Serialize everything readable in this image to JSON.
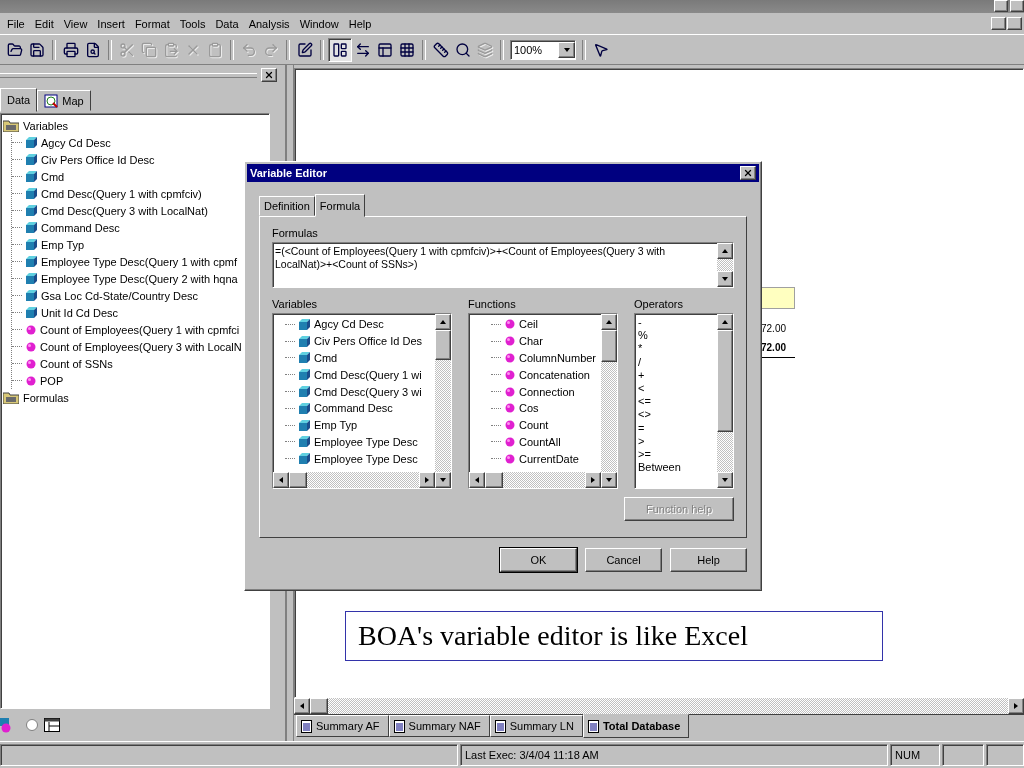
{
  "menu": [
    "File",
    "Edit",
    "View",
    "Insert",
    "Format",
    "Tools",
    "Data",
    "Analysis",
    "Window",
    "Help"
  ],
  "toolbar": [
    {
      "kind": "open",
      "disabled": false
    },
    {
      "kind": "save",
      "disabled": false
    },
    {
      "kind": "separator"
    },
    {
      "kind": "print",
      "disabled": false
    },
    {
      "kind": "preview",
      "disabled": false
    },
    {
      "kind": "separator"
    },
    {
      "kind": "cut",
      "disabled": true
    },
    {
      "kind": "copy",
      "disabled": true
    },
    {
      "kind": "paste",
      "disabled": true
    },
    {
      "kind": "delete",
      "disabled": true
    },
    {
      "kind": "clipboard",
      "disabled": true
    },
    {
      "kind": "separator"
    },
    {
      "kind": "undo",
      "disabled": true
    },
    {
      "kind": "redo",
      "disabled": true
    },
    {
      "kind": "separator"
    },
    {
      "kind": "format",
      "disabled": false
    },
    {
      "kind": "separator"
    },
    {
      "kind": "report",
      "disabled": false,
      "pressed": true
    },
    {
      "kind": "pivot",
      "disabled": false
    },
    {
      "kind": "layout",
      "disabled": false
    },
    {
      "kind": "grid",
      "disabled": false
    },
    {
      "kind": "separator"
    },
    {
      "kind": "ruler",
      "disabled": false
    },
    {
      "kind": "find",
      "disabled": false
    },
    {
      "kind": "drill",
      "disabled": true
    },
    {
      "kind": "separator"
    },
    {
      "kind": "zoom",
      "value": "100%"
    },
    {
      "kind": "separator"
    },
    {
      "kind": "help",
      "disabled": false
    }
  ],
  "view_option": {
    "checked": false
  },
  "left_panel": {
    "tabs": [
      {
        "label": "Data",
        "selected": true
      },
      {
        "label": "Map",
        "selected": false
      }
    ],
    "tree": [
      {
        "label": "Variables",
        "kind": "folder",
        "children": [
          {
            "label": "Agcy Cd Desc",
            "kind": "dimension"
          },
          {
            "label": "Civ Pers Office Id Desc",
            "kind": "dimension"
          },
          {
            "label": "Cmd",
            "kind": "dimension"
          },
          {
            "label": "Cmd Desc(Query 1 with cpmfciv)",
            "kind": "dimension"
          },
          {
            "label": "Cmd Desc(Query 3 with LocalNat)",
            "kind": "dimension"
          },
          {
            "label": "Command Desc",
            "kind": "dimension"
          },
          {
            "label": "Emp Typ",
            "kind": "dimension"
          },
          {
            "label": "Employee Type Desc(Query 1 with cpmf",
            "kind": "dimension"
          },
          {
            "label": "Employee Type Desc(Query 2 with hqna",
            "kind": "dimension"
          },
          {
            "label": "Gsa Loc Cd-State/Country Desc",
            "kind": "dimension"
          },
          {
            "label": "Unit Id Cd Desc",
            "kind": "dimension"
          },
          {
            "label": "Count of Employees(Query 1 with cpmfci",
            "kind": "measure"
          },
          {
            "label": "Count of Employees(Query 3 with LocalN",
            "kind": "measure"
          },
          {
            "label": "Count of SSNs",
            "kind": "measure"
          },
          {
            "label": "POP",
            "kind": "measure"
          }
        ]
      },
      {
        "label": "Formulas",
        "kind": "folder"
      }
    ]
  },
  "report": {
    "values": [
      {
        "text": "72.00",
        "bold": false
      },
      {
        "text": "72.00",
        "bold": true
      }
    ]
  },
  "callout": "BOA's variable editor is like Excel",
  "sheet_tabs": [
    {
      "label": "Summary AF",
      "selected": false
    },
    {
      "label": "Summary NAF",
      "selected": false
    },
    {
      "label": "Summary LN",
      "selected": false
    },
    {
      "label": "Total Database",
      "selected": true
    }
  ],
  "status_bar": {
    "message": "Last Exec: 3/4/04  11:18 AM",
    "indicator": "NUM"
  },
  "dialog": {
    "title": "Variable Editor",
    "tabs": [
      {
        "label": "Definition",
        "selected": false
      },
      {
        "label": "Formula",
        "selected": true
      }
    ],
    "formulas_label": "Formulas",
    "formula": "=(<Count of Employees(Query 1 with cpmfciv)>+<Count of Employees(Query 3 with LocalNat)>+<Count of SSNs>)",
    "variables_label": "Variables",
    "variables": [
      {
        "label": "Agcy Cd Desc",
        "kind": "dimension"
      },
      {
        "label": "Civ Pers Office Id Des",
        "kind": "dimension"
      },
      {
        "label": "Cmd",
        "kind": "dimension"
      },
      {
        "label": "Cmd Desc(Query 1 wi",
        "kind": "dimension"
      },
      {
        "label": "Cmd Desc(Query 3 wi",
        "kind": "dimension"
      },
      {
        "label": "Command Desc",
        "kind": "dimension"
      },
      {
        "label": "Emp Typ",
        "kind": "dimension"
      },
      {
        "label": "Employee Type Desc",
        "kind": "dimension"
      },
      {
        "label": "Employee Type Desc",
        "kind": "dimension"
      }
    ],
    "functions_label": "Functions",
    "functions": [
      "Ceil",
      "Char",
      "ColumnNumber",
      "Concatenation",
      "Connection",
      "Cos",
      "Count",
      "CountAll",
      "CurrentDate"
    ],
    "operators_label": "Operators",
    "operators": [
      "-",
      "%",
      "*",
      "/",
      "+",
      "<",
      "<=",
      "<>",
      "=",
      ">",
      ">=",
      "Between"
    ],
    "function_help": {
      "label": "Function help",
      "disabled": true
    },
    "buttons": [
      "OK",
      "Cancel",
      "Help"
    ]
  }
}
